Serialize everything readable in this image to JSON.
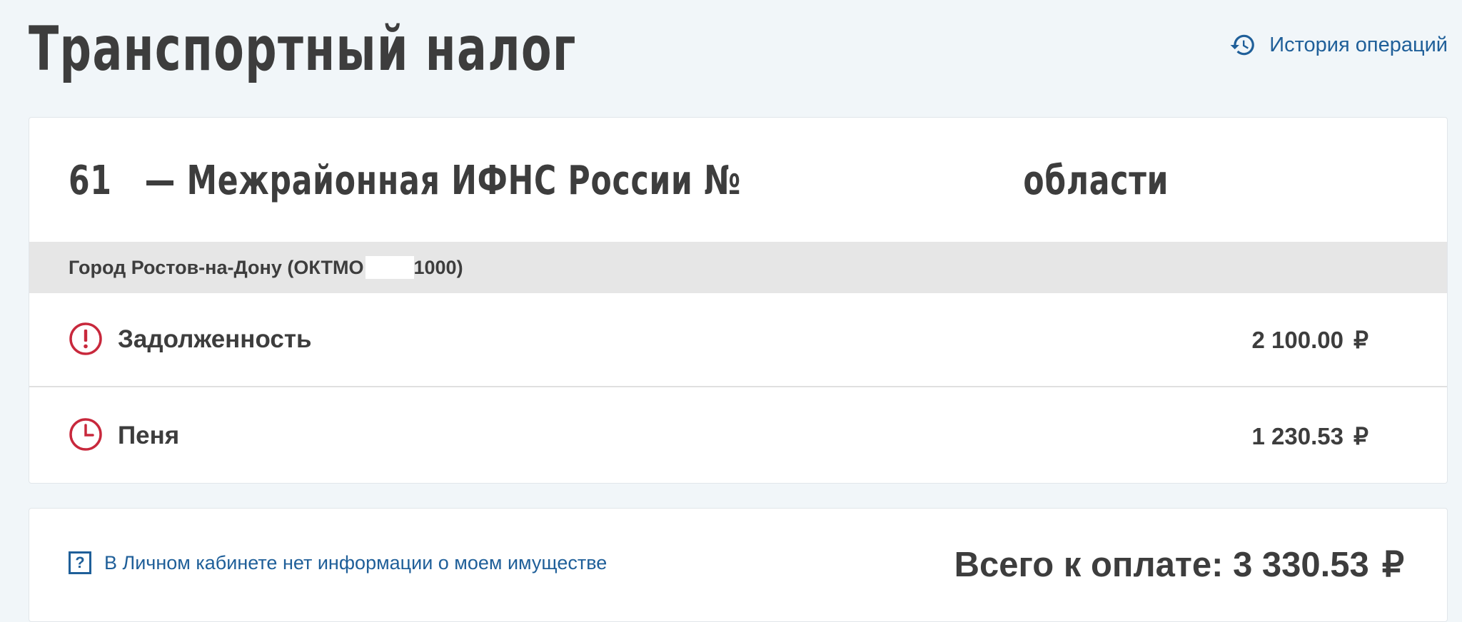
{
  "header": {
    "title": "Транспортный налог",
    "history_link": "История операций"
  },
  "inspection": {
    "code_prefix": "61",
    "name_part1": " — Межрайонная ИФНС России №",
    "name_part2": "области"
  },
  "municipality": {
    "label_prefix": "Город Ростов-на-Дону (ОКТМО",
    "label_suffix": "1000)"
  },
  "rows": {
    "debt": {
      "label": "Задолженность",
      "amount": "2 100.00",
      "currency": "₽"
    },
    "penalty": {
      "label": "Пеня",
      "amount": "1 230.53",
      "currency": "₽"
    }
  },
  "footer": {
    "no_info_link": "В Личном кабинете нет информации о моем имуществе",
    "question_mark": "?",
    "total_label": "Всего к оплате:",
    "total_amount": "3 330.53",
    "currency": "₽"
  },
  "colors": {
    "background": "#f1f6f9",
    "link": "#1f5f99",
    "alert": "#c8283c",
    "text": "#3d3d3d"
  },
  "icons": {
    "history": "history-icon",
    "debt": "exclamation-circle-icon",
    "penalty": "clock-icon",
    "help": "question-square-icon"
  }
}
